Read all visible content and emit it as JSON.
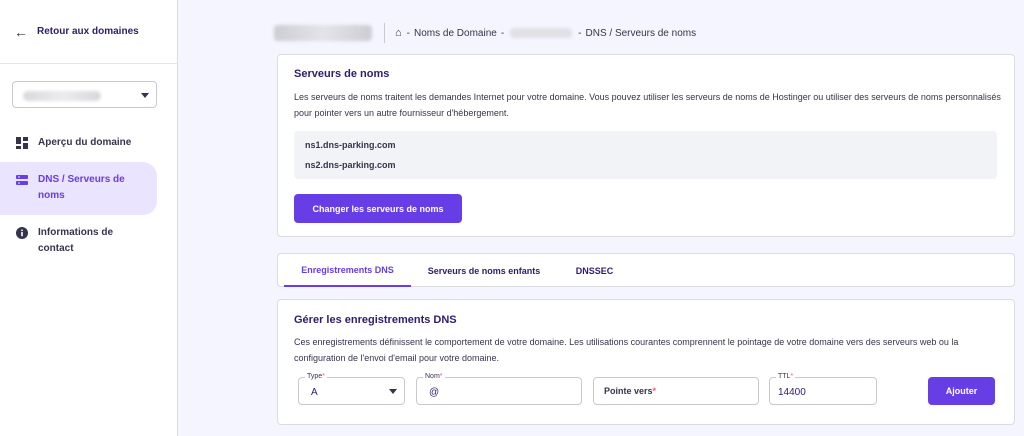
{
  "sidebar": {
    "back_label": "Retour aux domaines",
    "items": [
      {
        "label": "Aperçu du domaine",
        "icon": "dashboard-icon"
      },
      {
        "label": "DNS / Serveurs de noms",
        "icon": "dns-server-icon"
      },
      {
        "label": "Informations de contact",
        "icon": "info-icon"
      }
    ]
  },
  "breadcrumb": {
    "part1": "Noms de Domaine",
    "part2": "DNS / Serveurs de noms",
    "separator": "-"
  },
  "nameservers": {
    "title": "Serveurs de noms",
    "description": "Les serveurs de noms traitent les demandes Internet pour votre domaine. Vous pouvez utiliser les serveurs de noms de Hostinger ou utiliser des serveurs de noms personnalisés pour pointer vers un autre fournisseur d'hébergement.",
    "servers": [
      "ns1.dns-parking.com",
      "ns2.dns-parking.com"
    ],
    "change_button": "Changer les serveurs de noms"
  },
  "tabs": [
    {
      "label": "Enregistrements DNS",
      "active": true
    },
    {
      "label": "Serveurs de noms enfants",
      "active": false
    },
    {
      "label": "DNSSEC",
      "active": false
    }
  ],
  "dns": {
    "title": "Gérer les enregistrements DNS",
    "description": "Ces enregistrements définissent le comportement de votre domaine. Les utilisations courantes comprennent le pointage de votre domaine vers des serveurs web ou la configuration de l'envoi d'email pour votre domaine.",
    "type_label": "Type",
    "type_value": "A",
    "name_label": "Nom",
    "name_value": "@",
    "points_to_placeholder": "Pointe vers",
    "ttl_label": "TTL",
    "ttl_value": "14400",
    "add_button": "Ajouter",
    "required_mark": "*"
  },
  "colors": {
    "accent": "#673de6",
    "active_bg": "#ebe4ff",
    "text": "#2f1c6a",
    "required": "#fc5185"
  }
}
